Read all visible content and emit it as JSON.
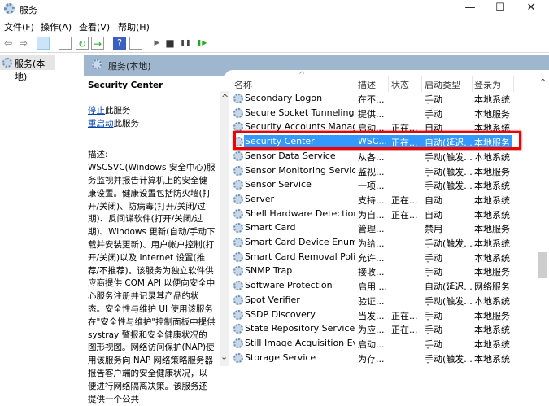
{
  "window": {
    "title": "服务",
    "minimize": "—",
    "maximize": "☐",
    "close": "✕"
  },
  "menu": [
    "文件(F)",
    "操作(A)",
    "查看(V)",
    "帮助(H)"
  ],
  "toolbar": {
    "back": "⇦",
    "forward": "⇨",
    "play": "▶",
    "stop": "■",
    "pause": "❚❚",
    "resume": "❚▶"
  },
  "tree": {
    "root": "服务(本地)"
  },
  "panel": {
    "title": "服务(本地)"
  },
  "details": {
    "service_name": "Security Center",
    "stop_link": "停止",
    "stop_suffix": "此服务",
    "restart_link": "重启动",
    "restart_suffix": "此服务",
    "desc_label": "描述:",
    "description": "WSCSVC(Windows 安全中心)服务监视并报告计算机上的安全健康设置。健康设置包括防火墙(打开/关闭)、防病毒(打开/关闭/过期)、反间谍软件(打开/关闭/过期)、Windows 更新(自动/手动下载并安装更新)、用户帐户控制(打开/关闭)以及 Internet 设置(推荐/不推荐)。该服务为独立软件供应商提供 COM API 以便向安全中心服务注册并记录其产品的状态。安全性与维护 UI 使用该服务在\"安全性与维护\"控制面板中提供 systray 警报和安全健康状况的图形视图。网络访问保护(NAP)使用该服务向 NAP 网络策略服务器报告客户端的安全健康状况，以便进行网络隔离决策。该服务还提供一个公共"
  },
  "columns": [
    "名称",
    "描述",
    "状态",
    "启动类型",
    "登录为"
  ],
  "sort_indicator": "^",
  "rows": [
    [
      "Secondary Logon",
      "在不...",
      "",
      "手动",
      "本地系统"
    ],
    [
      "Secure Socket Tunneling ...",
      "提供...",
      "",
      "手动",
      "本地服务"
    ],
    [
      "Security Accounts Manag...",
      "启动...",
      "正在...",
      "自动",
      "本地系统"
    ],
    [
      "Security Center",
      "WSC...",
      "正在...",
      "自动(延迟...",
      "本地服务"
    ],
    [
      "Sensor Data Service",
      "从各...",
      "",
      "手动(触发...",
      "本地系统"
    ],
    [
      "Sensor Monitoring Service",
      "监视...",
      "",
      "手动(触发...",
      "本地服务"
    ],
    [
      "Sensor Service",
      "一项...",
      "",
      "手动(触发...",
      "本地系统"
    ],
    [
      "Server",
      "支持...",
      "正在...",
      "自动",
      "本地系统"
    ],
    [
      "Shell Hardware Detection",
      "为自...",
      "正在...",
      "自动",
      "本地系统"
    ],
    [
      "Smart Card",
      "管理...",
      "",
      "禁用",
      "本地服务"
    ],
    [
      "Smart Card Device Enum...",
      "为给...",
      "",
      "手动(触发...",
      "本地系统"
    ],
    [
      "Smart Card Removal Poli...",
      "允许...",
      "",
      "手动",
      "本地系统"
    ],
    [
      "SNMP Trap",
      "接收...",
      "",
      "手动",
      "本地服务"
    ],
    [
      "Software Protection",
      "启用 ...",
      "",
      "自动(延迟...",
      "网络服务"
    ],
    [
      "Spot Verifier",
      "验证...",
      "",
      "手动(触发...",
      "本地系统"
    ],
    [
      "SSDP Discovery",
      "当发...",
      "正在...",
      "手动",
      "本地服务"
    ],
    [
      "State Repository Service",
      "为应...",
      "正在...",
      "手动",
      "本地系统"
    ],
    [
      "Still Image Acquisition Ev...",
      "启动...",
      "",
      "手动",
      "本地系统"
    ],
    [
      "Storage Service",
      "为存...",
      "",
      "手动(触发...",
      "本地系统"
    ]
  ],
  "selected_index": 3,
  "scroll": {
    "up": "^",
    "down": "⌄"
  }
}
